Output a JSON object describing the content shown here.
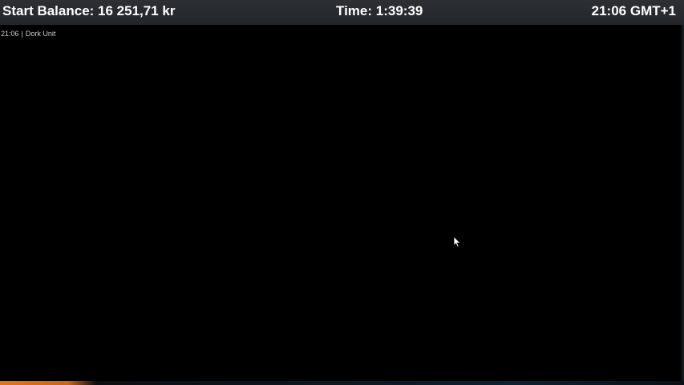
{
  "header": {
    "balance": "Start Balance: 16 251,71 kr",
    "timer": "Time: 1:39:39",
    "clock": "21:06 GMT+1"
  },
  "subline": {
    "time": "21:06",
    "separator": "|",
    "label": "Dork Unit"
  },
  "colors": {
    "header_bg": "#2c3034",
    "accent_orange": "#e0751c"
  },
  "icons": {
    "cursor": "mouse-pointer-icon"
  }
}
